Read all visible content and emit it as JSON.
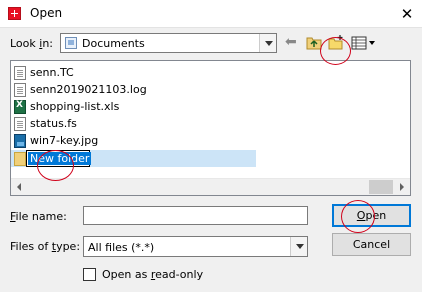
{
  "window": {
    "title": "Open",
    "close_glyph": "✕"
  },
  "toolbar": {
    "look_in_prefix": "Look ",
    "look_in_accel": "i",
    "look_in_suffix": "n:",
    "look_in_value": "Documents",
    "back_glyph": "⬅",
    "icons": [
      "back-icon",
      "up-one-level-icon",
      "create-new-folder-icon",
      "view-menu-icon"
    ]
  },
  "files": [
    {
      "name": "senn.TC",
      "icon": "document-icon"
    },
    {
      "name": "senn2019021103.log",
      "icon": "document-icon"
    },
    {
      "name": "shopping-list.xls",
      "icon": "excel-icon"
    },
    {
      "name": "status.fs",
      "icon": "document-icon"
    },
    {
      "name": "win7-key.jpg",
      "icon": "image-icon"
    }
  ],
  "rename": {
    "value": "New folder",
    "icon": "folder-icon"
  },
  "form": {
    "file_name_accel": "F",
    "file_name_suffix": "ile name:",
    "file_name_value": "",
    "file_type_prefix": "Files of ",
    "file_type_accel": "t",
    "file_type_suffix": "ype:",
    "file_type_value": "All files (*.*)",
    "open_accel": "O",
    "open_suffix": "pen",
    "cancel_label": "Cancel",
    "read_only_prefix": "Open as ",
    "read_only_accel": "r",
    "read_only_suffix": "ead-only",
    "read_only_checked": false
  },
  "annotations": {
    "color": "#d0021b",
    "count": 3
  }
}
